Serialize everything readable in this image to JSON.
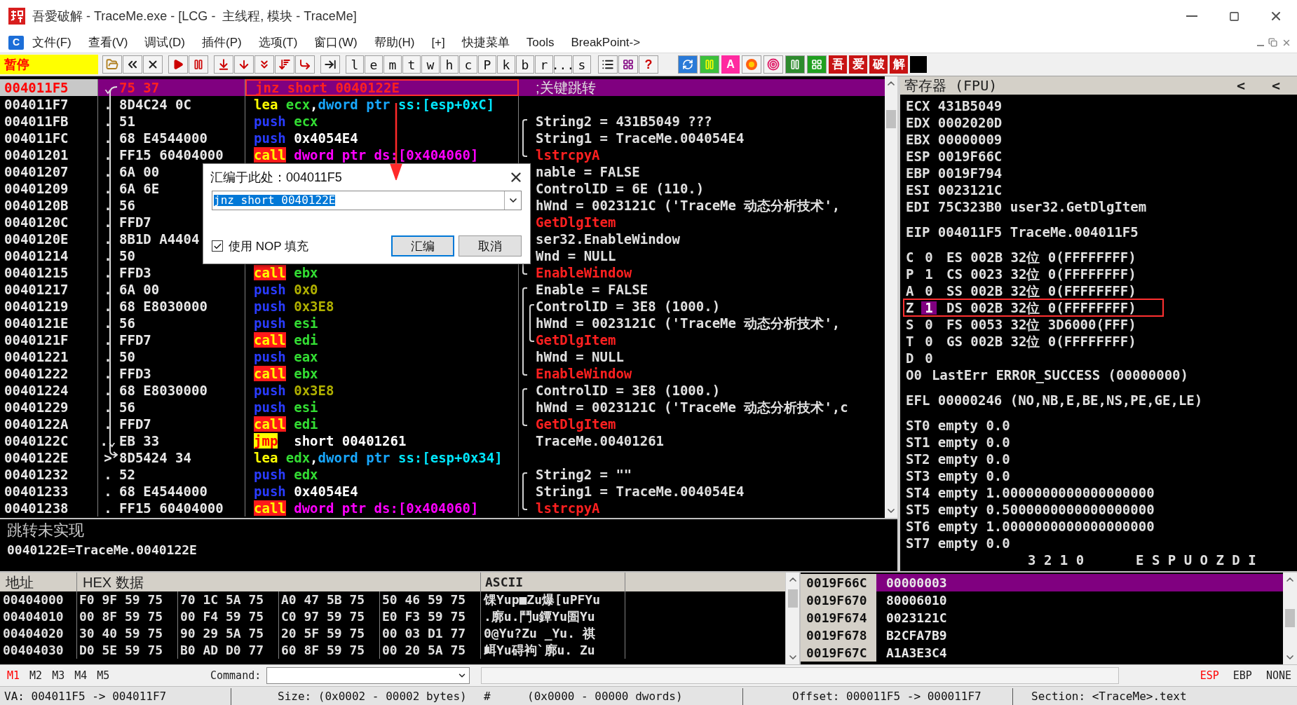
{
  "window": {
    "title": "吾愛破解 - TraceMe.exe - [LCG -  主线程, 模块 - TraceMe]"
  },
  "menu": {
    "system_letter": "C",
    "items": [
      "文件(F)",
      "查看(V)",
      "调试(D)",
      "插件(P)",
      "选项(T)",
      "窗口(W)",
      "帮助(H)",
      "[+]",
      "快捷菜单",
      "Tools",
      "BreakPoint->"
    ]
  },
  "toolbar": {
    "status": "暂停",
    "letters": [
      "l",
      "e",
      "m",
      "t",
      "w",
      "h",
      "c",
      "P",
      "k",
      "b",
      "r",
      "...",
      "s"
    ],
    "help": "?",
    "plugin_letter": "A",
    "crack_buttons": [
      "吾",
      "爱",
      "破",
      "解"
    ]
  },
  "disasm": {
    "rows": [
      {
        "address": "004011F5",
        "marker": "⌄",
        "hex": "75 37",
        "mnemonic": "jnz",
        "kind": "jcc",
        "operands": [
          {
            "text": "short 0040122E",
            "kind": "plain"
          }
        ],
        "comment": {
          "text": ";关键跳转",
          "kind": "note"
        },
        "selected": true,
        "annotated": true
      },
      {
        "address": "004011F7",
        "marker": ".",
        "hex": "8D4C24 0C",
        "mnemonic": "lea",
        "kind": "lea",
        "operands": [
          {
            "text": "ecx",
            "kind": "reg"
          },
          {
            "text": ",",
            "kind": "plain"
          },
          {
            "text": "dword ptr",
            "kind": "ptr"
          },
          {
            "text": " ss:[esp+0xC]",
            "kind": "mem"
          }
        ],
        "selected": false,
        "annotated": false
      },
      {
        "address": "004011FB",
        "marker": ".",
        "hex": "51",
        "mnemonic": "push",
        "kind": "push",
        "operands": [
          {
            "text": "ecx",
            "kind": "reg"
          }
        ],
        "comment": {
          "text": "String2 = 431B5049 ???",
          "kind": "note"
        },
        "brackets": [
          {
            "kind": "start"
          }
        ],
        "selected": false,
        "annotated": false
      },
      {
        "address": "004011FC",
        "marker": ".",
        "hex": "68 E4544000",
        "mnemonic": "push",
        "kind": "push",
        "operands": [
          {
            "text": "0x4054E4",
            "kind": "plain"
          }
        ],
        "comment": {
          "text": "String1 = TraceMe.004054E4",
          "kind": "note"
        },
        "brackets": [
          {
            "kind": "mid"
          }
        ],
        "selected": false,
        "annotated": false
      },
      {
        "address": "00401201",
        "marker": ".",
        "hex": "FF15 60404000",
        "mnemonic": "call",
        "kind": "call",
        "operands": [
          {
            "text": "dword ptr ds:[0x404060]",
            "kind": "far"
          }
        ],
        "comment": {
          "text": "lstrcpyA",
          "kind": "api"
        },
        "brackets": [
          {
            "kind": "end"
          }
        ],
        "selected": false,
        "annotated": false
      },
      {
        "address": "00401207",
        "marker": ".",
        "hex": "6A 00",
        "comment": {
          "text": "nable = FALSE",
          "kind": "note"
        },
        "selected": false
      },
      {
        "address": "00401209",
        "marker": ".",
        "hex": "6A 6E",
        "comment": {
          "text": "ControlID = 6E (110.)",
          "kind": "note"
        },
        "selected": false
      },
      {
        "address": "0040120B",
        "marker": ".",
        "hex": "56",
        "comment": {
          "text": "hWnd = 0023121C ('TraceMe 动态分析技术',",
          "kind": "note"
        },
        "selected": false
      },
      {
        "address": "0040120C",
        "marker": ".",
        "hex": "FFD7",
        "comment": {
          "text": "GetDlgItem",
          "kind": "api"
        },
        "selected": false
      },
      {
        "address": "0040120E",
        "marker": ".",
        "hex": "8B1D A4404",
        "comment": {
          "text": "ser32.EnableWindow",
          "kind": "note"
        },
        "selected": false
      },
      {
        "address": "00401214",
        "marker": ".",
        "hex": "50",
        "comment": {
          "text": "Wnd = NULL",
          "kind": "note"
        },
        "selected": false
      },
      {
        "address": "00401215",
        "marker": ".",
        "hex": "FFD3",
        "mnemonic": "call",
        "kind": "call",
        "operands": [
          {
            "text": "ebx",
            "kind": "reg"
          }
        ],
        "comment": {
          "text": "EnableWindow",
          "kind": "api"
        },
        "brackets": [
          {
            "kind": "end"
          }
        ],
        "selected": false,
        "annotated": false
      },
      {
        "address": "00401217",
        "marker": ".",
        "hex": "6A 00",
        "mnemonic": "push",
        "kind": "push",
        "operands": [
          {
            "text": "0x0",
            "kind": "const"
          }
        ],
        "comment": {
          "text": "Enable = FALSE",
          "kind": "note"
        },
        "brackets": [
          {
            "kind": "start"
          }
        ],
        "selected": false,
        "annotated": false
      },
      {
        "address": "00401219",
        "marker": ".",
        "hex": "68 E8030000",
        "mnemonic": "push",
        "kind": "push",
        "operands": [
          {
            "text": "0x3E8",
            "kind": "const"
          }
        ],
        "comment": {
          "text": "ControlID = 3E8 (1000.)",
          "kind": "note"
        },
        "brackets": [
          {
            "kind": "mid"
          },
          {
            "kind": "start"
          }
        ],
        "selected": false,
        "annotated": false
      },
      {
        "address": "0040121E",
        "marker": ".",
        "hex": "56",
        "mnemonic": "push",
        "kind": "push",
        "operands": [
          {
            "text": "esi",
            "kind": "reg"
          }
        ],
        "comment": {
          "text": "hWnd = 0023121C ('TraceMe 动态分析技术',",
          "kind": "note"
        },
        "brackets": [
          {
            "kind": "mid"
          },
          {
            "kind": "mid"
          }
        ],
        "selected": false,
        "annotated": false
      },
      {
        "address": "0040121F",
        "marker": ".",
        "hex": "FFD7",
        "mnemonic": "call",
        "kind": "call",
        "operands": [
          {
            "text": "edi",
            "kind": "reg"
          }
        ],
        "comment": {
          "text": "GetDlgItem",
          "kind": "api"
        },
        "brackets": [
          {
            "kind": "mid"
          },
          {
            "kind": "end"
          }
        ],
        "selected": false,
        "annotated": false
      },
      {
        "address": "00401221",
        "marker": ".",
        "hex": "50",
        "mnemonic": "push",
        "kind": "push",
        "operands": [
          {
            "text": "eax",
            "kind": "reg"
          }
        ],
        "comment": {
          "text": "hWnd = NULL",
          "kind": "note"
        },
        "brackets": [
          {
            "kind": "mid"
          }
        ],
        "selected": false,
        "annotated": false
      },
      {
        "address": "00401222",
        "marker": ".",
        "hex": "FFD3",
        "mnemonic": "call",
        "kind": "call",
        "operands": [
          {
            "text": "ebx",
            "kind": "reg"
          }
        ],
        "comment": {
          "text": "EnableWindow",
          "kind": "api"
        },
        "brackets": [
          {
            "kind": "end"
          }
        ],
        "selected": false,
        "annotated": false
      },
      {
        "address": "00401224",
        "marker": ".",
        "hex": "68 E8030000",
        "mnemonic": "push",
        "kind": "push",
        "operands": [
          {
            "text": "0x3E8",
            "kind": "const"
          }
        ],
        "comment": {
          "text": "ControlID = 3E8 (1000.)",
          "kind": "note"
        },
        "brackets": [
          {
            "kind": "start"
          }
        ],
        "selected": false,
        "annotated": false
      },
      {
        "address": "00401229",
        "marker": ".",
        "hex": "56",
        "mnemonic": "push",
        "kind": "push",
        "operands": [
          {
            "text": "esi",
            "kind": "reg"
          }
        ],
        "comment": {
          "text": "hWnd = 0023121C ('TraceMe 动态分析技术',c",
          "kind": "note"
        },
        "brackets": [
          {
            "kind": "mid"
          }
        ],
        "selected": false,
        "annotated": false
      },
      {
        "address": "0040122A",
        "marker": ".",
        "hex": "FFD7",
        "mnemonic": "call",
        "kind": "call",
        "operands": [
          {
            "text": "edi",
            "kind": "reg"
          }
        ],
        "comment": {
          "text": "GetDlgItem",
          "kind": "api"
        },
        "brackets": [
          {
            "kind": "end"
          }
        ],
        "selected": false,
        "annotated": false
      },
      {
        "address": "0040122C",
        "marker": ".⌄",
        "hex": "EB 33",
        "mnemonic": "jmp",
        "kind": "jmp",
        "operands": [
          {
            "text": " short 00401261",
            "kind": "plain"
          }
        ],
        "comment": {
          "text": "TraceMe.00401261",
          "kind": "note"
        },
        "selected": false,
        "annotated": false
      },
      {
        "address": "0040122E",
        "marker": ">",
        "hex": "8D5424 34",
        "mnemonic": "lea",
        "kind": "lea",
        "operands": [
          {
            "text": "edx",
            "kind": "reg"
          },
          {
            "text": ",",
            "kind": "plain"
          },
          {
            "text": "dword ptr",
            "kind": "ptr"
          },
          {
            "text": " ss:[esp+0x34]",
            "kind": "mem"
          }
        ],
        "selected": false,
        "annotated": false
      },
      {
        "address": "00401232",
        "marker": ".",
        "hex": "52",
        "mnemonic": "push",
        "kind": "push",
        "operands": [
          {
            "text": "edx",
            "kind": "reg"
          }
        ],
        "comment": {
          "text": "String2 = \"\"",
          "kind": "note"
        },
        "brackets": [
          {
            "kind": "start"
          }
        ],
        "selected": false,
        "annotated": false
      },
      {
        "address": "00401233",
        "marker": ".",
        "hex": "68 E4544000",
        "mnemonic": "push",
        "kind": "push",
        "operands": [
          {
            "text": "0x4054E4",
            "kind": "plain"
          }
        ],
        "comment": {
          "text": "String1 = TraceMe.004054E4",
          "kind": "note"
        },
        "brackets": [
          {
            "kind": "mid"
          }
        ],
        "selected": false,
        "annotated": false
      },
      {
        "address": "00401238",
        "marker": ".",
        "hex": "FF15 60404000",
        "mnemonic": "call",
        "kind": "call",
        "operands": [
          {
            "text": "dword ptr ds:[0x404060]",
            "kind": "far"
          }
        ],
        "comment": {
          "text": "lstrcpyA",
          "kind": "api"
        },
        "brackets": [
          {
            "kind": "end"
          }
        ],
        "selected": false,
        "annotated": false
      }
    ]
  },
  "dialog": {
    "title": "汇编于此处：004011F5",
    "value": "jnz short 0040122E",
    "nop_fill": {
      "label": "使用 NOP 填充",
      "checked": true
    },
    "buttons": [
      {
        "label": "汇编",
        "default": true
      },
      {
        "label": "取消",
        "default": false
      }
    ]
  },
  "info": {
    "lines": [
      "跳转未实现",
      "0040122E=TraceMe.0040122E"
    ]
  },
  "registers": {
    "title": "寄存器 (FPU)",
    "nav": [
      "<",
      "<"
    ],
    "lines": [
      {
        "kind": "text",
        "text": "ECX 431B5049"
      },
      {
        "kind": "text",
        "text": "EDX 0002020D"
      },
      {
        "kind": "text",
        "text": "EBX 00000009"
      },
      {
        "kind": "text",
        "text": "ESP 0019F66C"
      },
      {
        "kind": "text",
        "text": "EBP 0019F794"
      },
      {
        "kind": "text",
        "text": "ESI 0023121C"
      },
      {
        "kind": "text",
        "text": "EDI 75C323B0 user32.GetDlgItem"
      },
      {
        "kind": "gap"
      },
      {
        "kind": "text",
        "text": "EIP 004011F5 TraceMe.004011F5"
      },
      {
        "kind": "gap"
      },
      {
        "kind": "flag",
        "flag": "C",
        "value": "0",
        "rest": "ES 002B 32位 0(FFFFFFFF)",
        "selected": false,
        "annotated": false
      },
      {
        "kind": "flag",
        "flag": "P",
        "value": "1",
        "rest": "CS 0023 32位 0(FFFFFFFF)",
        "selected": false,
        "annotated": false
      },
      {
        "kind": "flag",
        "flag": "A",
        "value": "0",
        "rest": "SS 002B 32位 0(FFFFFFFF)",
        "selected": false,
        "annotated": false
      },
      {
        "kind": "flag",
        "flag": "Z",
        "value": "1",
        "rest": "DS 002B 32位 0(FFFFFFFF)",
        "selected": true,
        "annotated": true
      },
      {
        "kind": "flag",
        "flag": "S",
        "value": "0",
        "rest": "FS 0053 32位 3D6000(FFF)",
        "selected": false,
        "annotated": false
      },
      {
        "kind": "flag",
        "flag": "T",
        "value": "0",
        "rest": "GS 002B 32位 0(FFFFFFFF)",
        "selected": false,
        "annotated": false
      },
      {
        "kind": "flag",
        "flag": "D",
        "value": "0",
        "selected": false,
        "annotated": false
      },
      {
        "kind": "flag",
        "flag": "O",
        "value": "0",
        "rest": "LastErr ERROR_SUCCESS (00000000)",
        "selected": false,
        "annotated": false
      },
      {
        "kind": "gap"
      },
      {
        "kind": "text",
        "text": "EFL 00000246 (NO,NB,E,BE,NS,PE,GE,LE)"
      },
      {
        "kind": "gap"
      },
      {
        "kind": "text",
        "text": "ST0 empty 0.0"
      },
      {
        "kind": "text",
        "text": "ST1 empty 0.0"
      },
      {
        "kind": "text",
        "text": "ST2 empty 0.0"
      },
      {
        "kind": "text",
        "text": "ST3 empty 0.0"
      },
      {
        "kind": "text",
        "text": "ST4 empty 1.0000000000000000000"
      },
      {
        "kind": "text",
        "text": "ST5 empty 0.5000000000000000000"
      },
      {
        "kind": "text",
        "text": "ST6 empty 1.0000000000000000000"
      },
      {
        "kind": "text",
        "text": "ST7 empty 0.0"
      }
    ],
    "footer": [
      "3 2 1 0",
      "E S P U O Z D I"
    ]
  },
  "dump": {
    "columns": [
      "地址",
      "HEX 数据",
      "ASCII"
    ],
    "rows": [
      {
        "address": "00404000",
        "hex": [
          "F0 9F 59 75",
          "70 1C 5A 75",
          "A0 47 5B 75",
          "50 46 59 75"
        ],
        "ascii": "馃Yup■Zu爆[uPFYu"
      },
      {
        "address": "00404010",
        "hex": [
          "00 8F 59 75",
          "00 F4 59 75",
          "C0 97 59 75",
          "E0 F3 59 75"
        ],
        "ascii": ".廓u.鬥u鐔Yu圄Yu"
      },
      {
        "address": "00404020",
        "hex": [
          "30 40 59 75",
          "90 29 5A 75",
          "20 5F 59 75",
          "00 03 D1 77"
        ],
        "ascii": "0@Yu?Zu _Yu. 祺"
      },
      {
        "address": "00404030",
        "hex": [
          "D0 5E 59 75",
          "B0 AD D0 77",
          "60 8F 59 75",
          "00 20 5A 75"
        ],
        "ascii": "衈Yu碍袧`廓u. Zu"
      }
    ]
  },
  "stack": {
    "rows": [
      {
        "address": "0019F66C",
        "value": "00000003",
        "selected": true
      },
      {
        "address": "0019F670",
        "value": "80006010",
        "selected": false
      },
      {
        "address": "0019F674",
        "value": "0023121C",
        "selected": false
      },
      {
        "address": "0019F678",
        "value": "B2CFA7B9",
        "selected": false
      },
      {
        "address": "0019F67C",
        "value": "A1A3E3C4",
        "selected": false
      }
    ]
  },
  "command_bar": {
    "marks": [
      {
        "label": "M1",
        "selected": true
      },
      {
        "label": "M2",
        "selected": false
      },
      {
        "label": "M3",
        "selected": false
      },
      {
        "label": "M4",
        "selected": false
      },
      {
        "label": "M5",
        "selected": false
      }
    ],
    "label": "Command:",
    "bases": [
      {
        "label": "ESP",
        "selected": true
      },
      {
        "label": "EBP",
        "selected": false
      },
      {
        "label": "NONE",
        "selected": false
      }
    ]
  },
  "status_bar": [
    "VA: 004011F5 -> 004011F7",
    "Size: (0x0002 - 00002 bytes)",
    "#",
    "(0x0000 - 00000 dwords)",
    "Offset: 000011F5 -> 000011F7",
    "Section: <TraceMe>.text"
  ]
}
